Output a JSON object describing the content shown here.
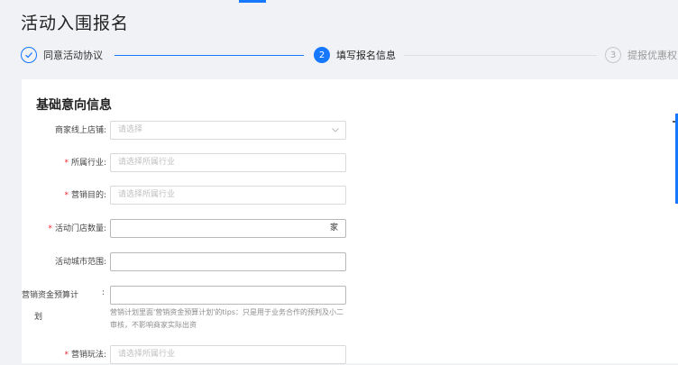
{
  "page": {
    "title": "活动入围报名"
  },
  "steps": [
    {
      "number": "✓",
      "label": "同意活动协议",
      "status": "done"
    },
    {
      "number": "2",
      "label": "填写报名信息",
      "status": "active"
    },
    {
      "number": "3",
      "label": "提报优惠权",
      "status": "wait"
    }
  ],
  "section": {
    "title": "基础意向信息"
  },
  "form": {
    "store": {
      "label": "商家线上店铺:",
      "placeholder": "请选择"
    },
    "industry": {
      "label": "所属行业:",
      "placeholder": "请选择所属行业"
    },
    "purpose": {
      "label": "营销目的:",
      "placeholder": "请选择所属行业"
    },
    "store_count": {
      "label": "活动门店数量:",
      "value": "",
      "suffix": "家"
    },
    "city_scope": {
      "label": "活动城市范围:",
      "value": ""
    },
    "budget": {
      "label_line1": "营销资金预算计",
      "label_colon": ":",
      "label_line2": "划",
      "value": "",
      "hint": "营销计划里面'营销资金预算计划'的tips：只是用于业务合作的预判及小二审核，不影响商家实际出资"
    },
    "play": {
      "label": "营销玩法:",
      "placeholder": "请选择所属行业"
    }
  },
  "colors": {
    "accent": "#1677ff",
    "required": "#f5222d",
    "background": "#f0f2f5"
  }
}
